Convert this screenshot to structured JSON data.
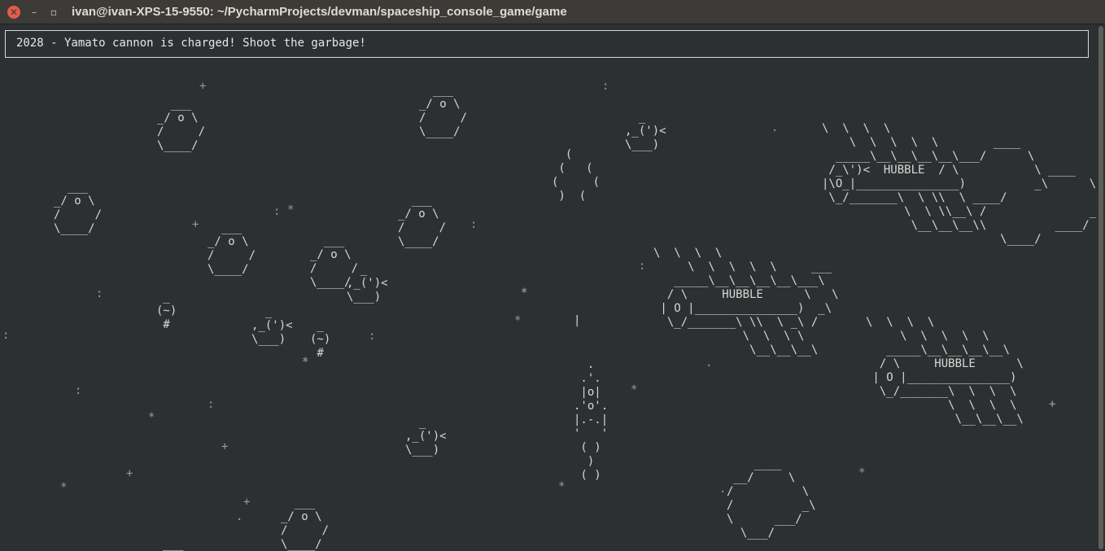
{
  "window": {
    "title": "ivan@ivan-XPS-15-9550: ~/PycharmProjects/devman/spaceship_console_game/game",
    "close_glyph": "✕",
    "minimize_glyph": "–",
    "maximize_glyph": "▫"
  },
  "status": {
    "text": "2028 - Yamato cannon is charged! Shoot the garbage!"
  },
  "sprites": {
    "asteroid": "  ___\n_/ o \\\n/     /\n\\____/",
    "asteroid_small": "   ___\n _/ o \\\n/     /\n\\____/",
    "trash_can": "  _\n,_(')<\n\\___)",
    "lamp": " _\n(~)\n #",
    "fire": "  (\n (   (\n(     (\n )  (",
    "lonely_bar": "|",
    "rocket": "  .\n .'.\n |o|\n.'o'.\n|.-.|\n'   '\n ( )\n  )\n ( )",
    "hubble": "\\  \\  \\  \\\n    \\  \\  \\  \\  \\        ____\n  _____\\__\\__\\__\\__\\___/      \\\n /_\\')<  HUBBLE  / \\           \\ ____\n|\\O_|_______________)          _\\      \\\n \\_/_______\\  \\ \\\\  \\ ____/             \\\n            \\  \\ \\\\__\\ /               _\\\n             \\__\\__\\__\\\\          ____/\n                          \\____/",
    "hubble_b": "\\  \\  \\  \\\n     \\  \\  \\  \\  \\     ___\n   _____\\__\\__\\__\\__\\___\\\n  / \\     HUBBLE      \\   \\\n | O |_______________)  _\\\n  \\_/_______\\ \\\\  \\ _\\ /\n             \\  \\  \\ \\\n              \\__\\__\\__\\",
    "hubble_c": "\\  \\  \\  \\\n     \\  \\  \\  \\  \\\n   _____\\__\\__\\__\\__\\\n  / \\     HUBBLE      \\\n | O |_______________)\n  \\_/_______\\  \\  \\  \\\n            \\  \\  \\  \\\n             \\__\\__\\__\\",
    "blob": "    ____\n __/     \\\n/          \\\n/          _\\\n\\      ___/\n  \\___/"
  },
  "stars": [
    "+",
    ":",
    ".",
    "*",
    "+",
    ":",
    "*",
    "+",
    ":",
    "*",
    ":",
    "*",
    "*",
    "+",
    ":",
    ":",
    "*",
    "+",
    "*",
    "+",
    ".",
    "*",
    ".",
    "*",
    "+",
    ":",
    "*",
    ":",
    ".",
    "*",
    ":",
    "."
  ]
}
